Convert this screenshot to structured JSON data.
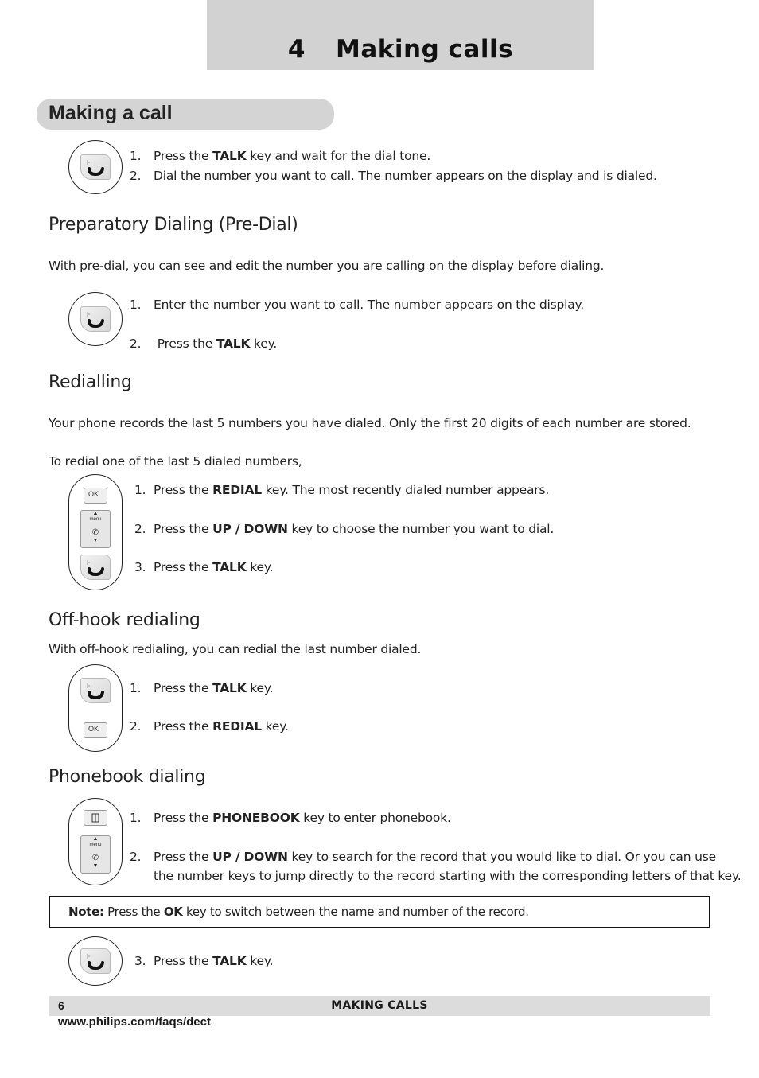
{
  "chapter": {
    "number": "4",
    "title": "Making calls"
  },
  "section": {
    "title": "Making a call"
  },
  "making_call": {
    "icon": "talk-key-icon",
    "steps": [
      {
        "n": "1.",
        "pre": "Press the ",
        "key": "TALK",
        "post": " key and wait for the dial tone."
      },
      {
        "n": "2.",
        "pre": "Dial the number you want to call. The number appears on the display and is dialed.",
        "key": "",
        "post": ""
      }
    ]
  },
  "predial": {
    "heading": "Preparatory Dialing (Pre-Dial)",
    "intro": "With pre-dial, you can see and edit the number you are calling on the display before dialing.",
    "icon": "talk-key-icon",
    "steps": [
      {
        "n": "1.",
        "pre": "Enter the number you want to call. The number appears on the display.",
        "key": "",
        "post": ""
      },
      {
        "n": "2.",
        "pre": " Press the ",
        "key": "TALK",
        "post": " key."
      }
    ]
  },
  "redialling": {
    "heading": "Redialling",
    "intro": "Your phone records the last 5 numbers you have dialed.  Only the first 20 digits of each number are stored.",
    "lead": "To redial one of the last 5 dialed numbers,",
    "icons": [
      "redial-key-icon",
      "nav-menu-key-icon",
      "talk-key-icon"
    ],
    "steps": [
      {
        "n": "1.",
        "pre": "Press the ",
        "key": "REDIAL",
        "post": " key.  The most recently dialed number appears."
      },
      {
        "n": "2.",
        "pre": "Press the ",
        "key": "UP / DOWN",
        "post": " key to choose the number you want to dial."
      },
      {
        "n": "3.",
        "pre": "Press the ",
        "key": "TALK",
        "post": " key."
      }
    ]
  },
  "offhook": {
    "heading": "Off-hook redialing",
    "intro": "With off-hook redialing, you can redial the last number dialed.",
    "icons": [
      "talk-key-icon",
      "redial-key-icon"
    ],
    "steps": [
      {
        "n": "1.",
        "pre": "Press the ",
        "key": "TALK",
        "post": " key."
      },
      {
        "n": "2.",
        "pre": "Press the ",
        "key": "REDIAL",
        "post": " key."
      }
    ]
  },
  "phonebook": {
    "heading": "Phonebook dialing",
    "icons": [
      "phonebook-key-icon",
      "nav-menu-key-icon"
    ],
    "steps": [
      {
        "n": "1.",
        "pre": "Press the ",
        "key": "PHONEBOOK",
        "post": " key to enter phonebook."
      },
      {
        "n": "2.",
        "pre": "Press the ",
        "key": "UP / DOWN",
        "post": " key to search for the record that you would like to dial.  Or you can use",
        "line2": "the number keys to jump directly to the record starting with the corresponding letters of that key."
      }
    ],
    "note": {
      "label": "Note:",
      "pre": " Press the ",
      "key": "OK",
      "post": " key to switch between the name and number of the record."
    },
    "final_step": {
      "n": "3.",
      "pre": "Press the ",
      "key": "TALK",
      "post": " key."
    }
  },
  "key_labels": {
    "ok": "OK",
    "menu": "menu"
  },
  "footer": {
    "page": "6",
    "title": "MAKING CALLS",
    "url": "www.philips.com/faqs/dect"
  }
}
